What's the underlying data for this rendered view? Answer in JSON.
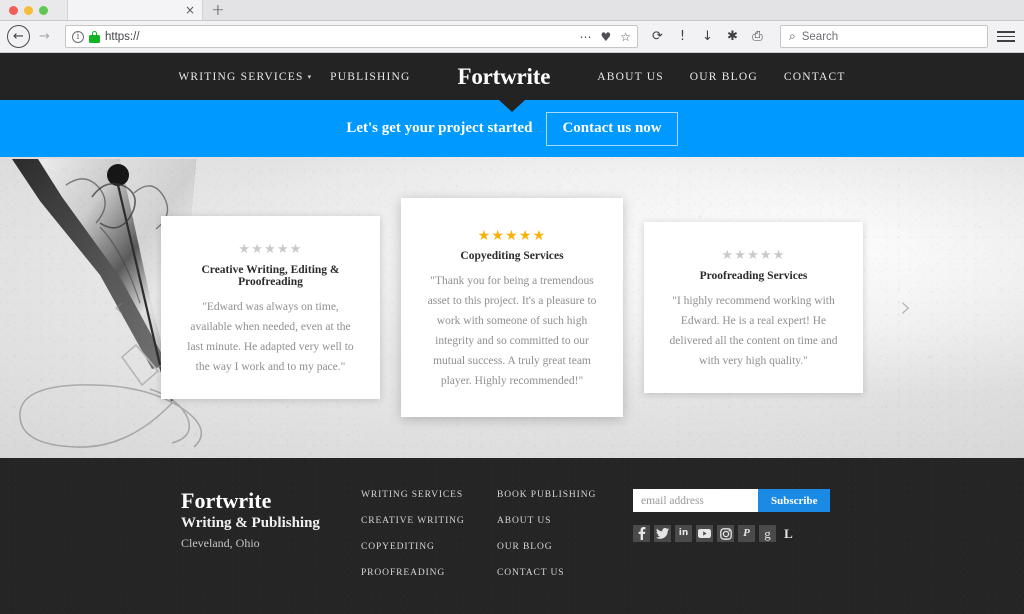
{
  "browser": {
    "tab_title": "",
    "tab_close_label": "×",
    "new_tab_label": "+",
    "back_label": "←",
    "forward_label": "→",
    "url_value": "https://",
    "url_info_label": "i",
    "reload_label": "⟳",
    "page_info_label": "!",
    "downloads_label": "↓",
    "settings_label": "✱",
    "print_label": "⎙",
    "more_label": "⋯",
    "pocket_label": "♥",
    "bookmark_label": "☆",
    "search_glyph": "⌕",
    "search_placeholder": "Search"
  },
  "site_nav": {
    "brand": "Fortwrite",
    "left_links": [
      {
        "label": "WRITING SERVICES",
        "has_caret": true
      },
      {
        "label": "PUBLISHING",
        "has_caret": false
      }
    ],
    "right_links": [
      {
        "label": "ABOUT US"
      },
      {
        "label": "OUR BLOG"
      },
      {
        "label": "CONTACT"
      }
    ],
    "caret_glyph": "▾",
    "bg_color": "#232323"
  },
  "cta": {
    "text": "Let's get your project started",
    "button_label": "Contact us now",
    "bg_color": "#0099ff"
  },
  "carousel": {
    "prev_label": "‹",
    "next_label": "›",
    "star_glyph": "★",
    "star_gold": "#f5b30a",
    "star_gray": "#c9c9c9",
    "cards": [
      {
        "stars": "★★★★★",
        "star_state": "gray",
        "title": "Creative Writing, Editing & Proofreading",
        "quote": "\"Edward was always on time, available when needed, even at the last minute. He adapted very well to the way I work and to my pace.\""
      },
      {
        "stars": "★★★★★",
        "star_state": "gold",
        "title": "Copyediting Services",
        "quote": "\"Thank you for being a tremendous asset to this project. It's a pleasure to work with someone of such high integrity and so committed to our mutual success. A truly great team player. Highly recommended!\""
      },
      {
        "stars": "★★★★★",
        "star_state": "gray",
        "title": "Proofreading Services",
        "quote": "\"I highly recommend working with Edward. He is a real expert! He delivered all the content on time and with very high quality.\""
      }
    ]
  },
  "footer": {
    "brand_name": "Fortwrite",
    "brand_sub": "Writing & Publishing",
    "brand_city": "Cleveland, Ohio",
    "col1": [
      "WRITING SERVICES",
      "CREATIVE WRITING",
      "COPYEDITING",
      "PROOFREADING"
    ],
    "col2": [
      "BOOK PUBLISHING",
      "ABOUT US",
      "OUR BLOG",
      "CONTACT US"
    ],
    "newsletter": {
      "placeholder": "email address",
      "value": "",
      "button_label": "Subscribe",
      "button_color": "#1a8ae5"
    },
    "socials": [
      {
        "name": "facebook",
        "label": "f"
      },
      {
        "name": "twitter",
        "label": ""
      },
      {
        "name": "linkedin",
        "label": "in"
      },
      {
        "name": "youtube",
        "label": ""
      },
      {
        "name": "instagram",
        "label": ""
      },
      {
        "name": "pinterest",
        "label": "P"
      },
      {
        "name": "google",
        "label": "g"
      },
      {
        "name": "letterboxd",
        "label": "L"
      }
    ]
  }
}
